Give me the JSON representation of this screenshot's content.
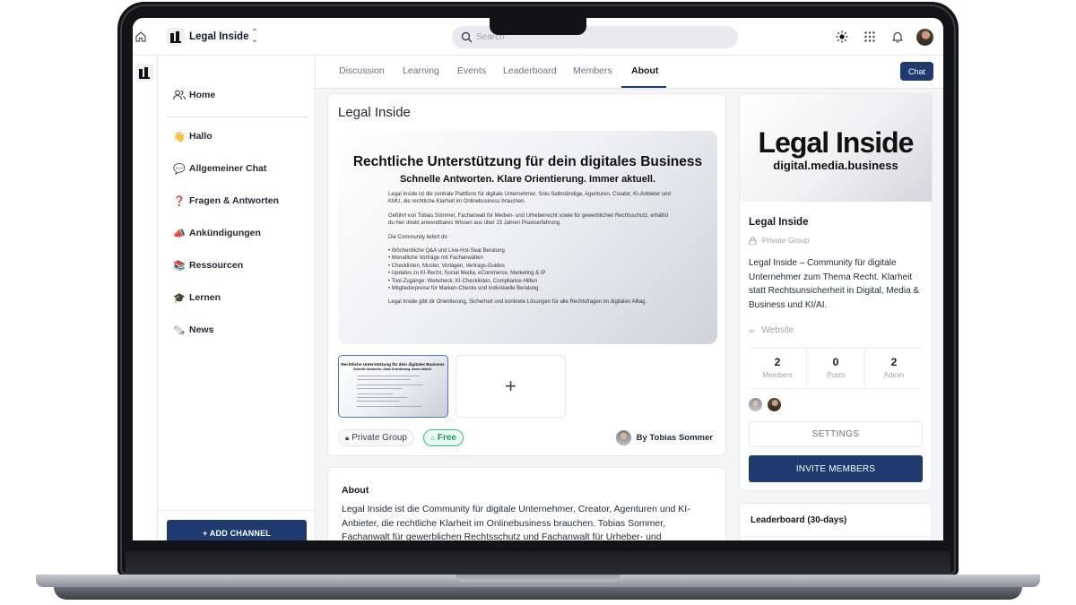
{
  "topbar": {
    "brand_name": "Legal Inside",
    "search_placeholder": "Search"
  },
  "sidebar": {
    "items": [
      {
        "emoji": "",
        "label": "Home"
      },
      {
        "emoji": "👋",
        "label": "Hallo"
      },
      {
        "emoji": "💬",
        "label": "Allgemeiner Chat"
      },
      {
        "emoji": "❓",
        "label": "Fragen & Antworten"
      },
      {
        "emoji": "📣",
        "label": "Ankündigungen"
      },
      {
        "emoji": "📚",
        "label": "Ressourcen"
      },
      {
        "emoji": "🎓",
        "label": "Lernen"
      },
      {
        "emoji": "🗞️",
        "label": "News"
      }
    ],
    "add_channel_label": "+ ADD CHANNEL"
  },
  "tabs": {
    "items": [
      "Discussion",
      "Learning",
      "Events",
      "Leaderboard",
      "Members",
      "About"
    ],
    "active": "About",
    "chat_label": "Chat"
  },
  "main": {
    "title": "Legal Inside",
    "hero": {
      "headline": "Rechtliche Unterstützung für dein digitales Business",
      "subheadline": "Schnelle Antworten. Klare Orientierung. Immer aktuell.",
      "p1": "Legal Inside ist die zentrale Plattform für digitale Unternehmer, Solo-Selbständige, Agenturen, Creator, KI-Anbieter und KMU, die rechtliche Klarheit im Onlinebusiness brauchen.",
      "p2": "Geführt von Tobias Sommer, Fachanwalt für Medien- und Urheberrecht sowie für gewerblichen Rechtsschutz, erhältst du hier direkt anwendbares Wissen aus über 15 Jahren Praxiserfahrung.",
      "p3": "Die Community liefert dir:",
      "bullets": [
        "• Wöchentliche Q&A und Live-Hot-Seat Beratung",
        "• Monatliche Vorträge mit Fachanwälten",
        "• Checklisten, Muster, Vorlagen, Vertrags-Guides",
        "• Updates zu KI-Recht, Social Media, eCommerce, Marketing & IP",
        "• Tool-Zugänge: Webcheck, KI-Checklisten, Compliance-Hilfen",
        "• Mitgliederpreise für Marken-Checks und individuelle Beratung"
      ],
      "p4": "Legal Inside gibt dir Orientierung, Sicherheit und konkrete Lösungen für alle Rechtsfragen im digitalen Alltag."
    },
    "thumb_title": "Rechtliche Unterstützung für dein digitales Business",
    "thumb_sub": "Schnelle Antworten. Klare Orientierung. Immer aktuell.",
    "add_image_symbol": "+",
    "privacy_label": "Private Group",
    "price_label": "Free",
    "author_label": "By Tobias Sommer"
  },
  "about": {
    "title": "About",
    "text": "Legal Inside ist die Community für digitale Unternehmer, Creator, Agenturen und KI-Anbieter, die rechtliche Klarheit im Onlinebusiness brauchen. Tobias Sommer, Fachanwalt für gewerblichen Rechtsschutz und Fachanwalt für Urheber- und Medienrecht, liefert"
  },
  "right_panel": {
    "banner_title": "Legal Inside",
    "banner_sub": "digital.media.business",
    "name": "Legal Inside",
    "privacy": "Private Group",
    "description": "Legal Inside – Community für digitale Unternehmer zum Thema Recht. Klarheit statt Rechtsunsicherheit in Digital, Media & Business und KI/AI.",
    "website_label": "Website",
    "stats": [
      {
        "value": "2",
        "label": "Members"
      },
      {
        "value": "0",
        "label": "Posts"
      },
      {
        "value": "2",
        "label": "Admin"
      }
    ],
    "settings_label": "SETTINGS",
    "invite_label": "INVITE MEMBERS"
  },
  "leaderboard": {
    "title": "Leaderboard (30-days)"
  },
  "colors": {
    "primary": "#1e3a6e",
    "free_green": "#1f9d5c",
    "thumb_border": "#4a78c2"
  }
}
